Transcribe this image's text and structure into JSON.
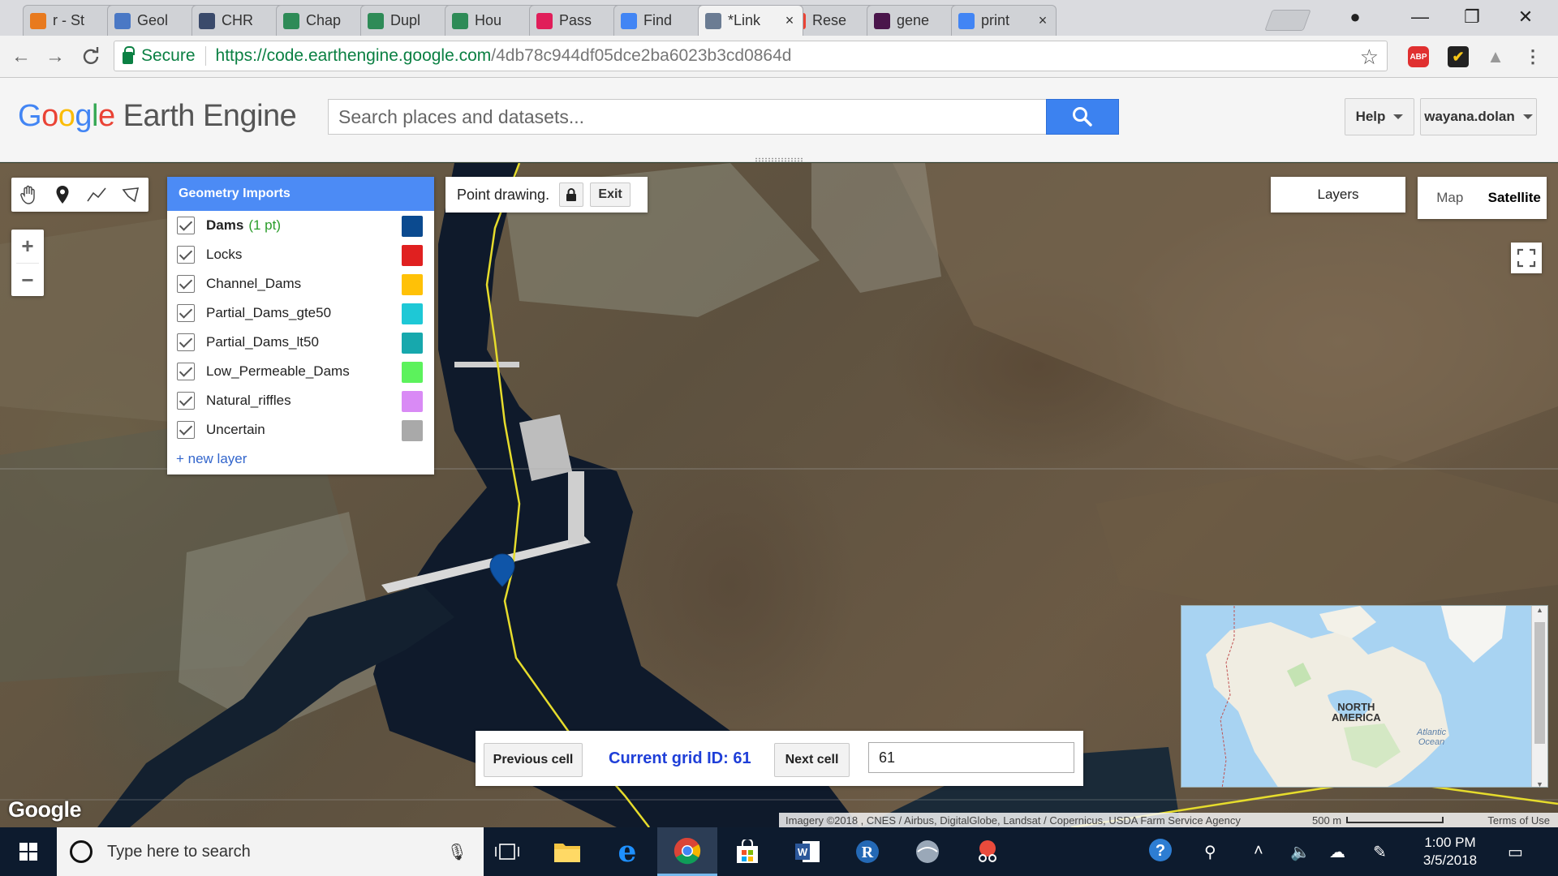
{
  "browser": {
    "tabs": [
      {
        "title": "r - St",
        "color": "#e87a1e",
        "active": false
      },
      {
        "title": "Geol",
        "color": "#4a78c5",
        "active": false
      },
      {
        "title": "CHR",
        "color": "#3a4a6b",
        "active": false
      },
      {
        "title": "Chap",
        "color": "#2e8b57",
        "active": false
      },
      {
        "title": "Dupl",
        "color": "#2e8b57",
        "active": false
      },
      {
        "title": "Hou",
        "color": "#2e8b57",
        "active": false
      },
      {
        "title": "Pass",
        "color": "#e01e5a",
        "active": false
      },
      {
        "title": "Find",
        "color": "#4285f4",
        "active": false
      },
      {
        "title": "*Link",
        "color": "#6b7c93",
        "active": true
      },
      {
        "title": "Rese",
        "color": "#ea4335",
        "active": false
      },
      {
        "title": "gene",
        "color": "#4a154b",
        "active": false
      },
      {
        "title": "print",
        "color": "#4285f4",
        "active": false
      }
    ],
    "close_glyph": "×",
    "secure_label": "Secure",
    "url_scheme_host": "https://code.earthengine.google.com",
    "url_path": "/4db78c944df05dce2ba6023b3cd0864d",
    "abp_label": "ABP"
  },
  "header": {
    "logo_google": [
      "G",
      "o",
      "o",
      "g",
      "l",
      "e"
    ],
    "logo_product": "Earth Engine",
    "search_placeholder": "Search places and datasets...",
    "help_label": "Help",
    "user_label": "wayana.dolan"
  },
  "geometry_imports": {
    "title": "Geometry Imports",
    "layers": [
      {
        "name": "Dams",
        "count": "(1 pt)",
        "color": "#0b4a8f",
        "bold": true
      },
      {
        "name": "Locks",
        "count": "",
        "color": "#e02020",
        "bold": false
      },
      {
        "name": "Channel_Dams",
        "count": "",
        "color": "#ffc107",
        "bold": false
      },
      {
        "name": "Partial_Dams_gte50",
        "count": "",
        "color": "#1ec8d6",
        "bold": false
      },
      {
        "name": "Partial_Dams_lt50",
        "count": "",
        "color": "#17a8ad",
        "bold": false
      },
      {
        "name": "Low_Permeable_Dams",
        "count": "",
        "color": "#5cf25c",
        "bold": false
      },
      {
        "name": "Natural_riffles",
        "count": "",
        "color": "#d98af5",
        "bold": false
      },
      {
        "name": "Uncertain",
        "count": "",
        "color": "#a9a9a9",
        "bold": false
      }
    ],
    "new_layer": "+ new layer"
  },
  "point_drawing": {
    "label": "Point drawing.",
    "exit_label": "Exit"
  },
  "map_controls": {
    "layers_label": "Layers",
    "map_label": "Map",
    "satellite_label": "Satellite",
    "zoom_in": "+",
    "zoom_out": "−"
  },
  "grid_panel": {
    "prev_label": "Previous cell",
    "current_label": "Current grid ID: 61",
    "next_label": "Next cell",
    "input_value": "61"
  },
  "minimap": {
    "continent_label_1": "NORTH",
    "continent_label_2": "AMERICA",
    "ocean_label_1": "Atlantic",
    "ocean_label_2": "Ocean"
  },
  "footer": {
    "watermark": "Google",
    "attribution": "Imagery ©2018 , CNES / Airbus, DigitalGlobe, Landsat / Copernicus, USDA Farm Service Agency",
    "scale_label": "500 m",
    "terms_label": "Terms of Use"
  },
  "taskbar": {
    "search_placeholder": "Type here to search",
    "time": "1:00 PM",
    "date": "3/5/2018"
  }
}
